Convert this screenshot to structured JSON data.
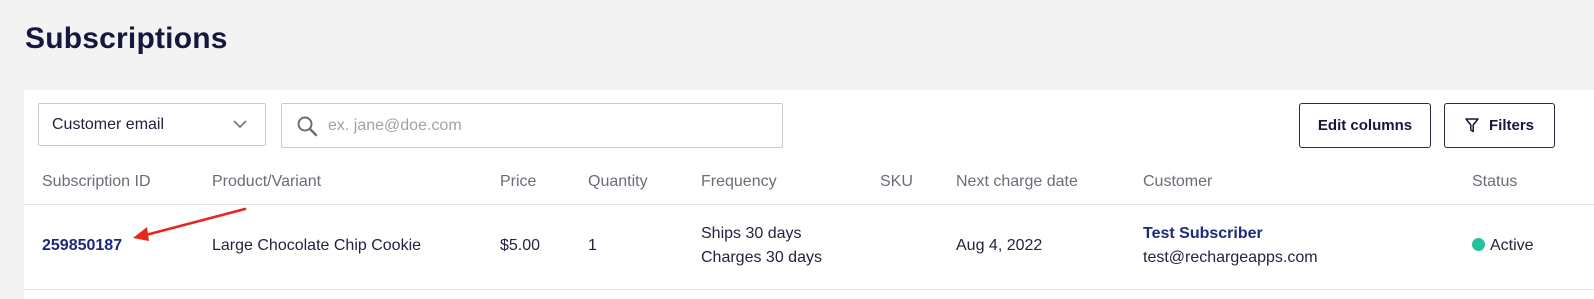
{
  "page": {
    "title": "Subscriptions"
  },
  "toolbar": {
    "filter_select": {
      "selected": "Customer email"
    },
    "search": {
      "placeholder": "ex. jane@doe.com",
      "value": ""
    },
    "edit_columns_label": "Edit columns",
    "filters_label": "Filters"
  },
  "table": {
    "headers": {
      "subscription_id": "Subscription ID",
      "product": "Product/Variant",
      "price": "Price",
      "quantity": "Quantity",
      "frequency": "Frequency",
      "sku": "SKU",
      "next_charge": "Next charge date",
      "customer": "Customer",
      "status": "Status"
    },
    "rows": [
      {
        "subscription_id": "259850187",
        "product": "Large Chocolate Chip Cookie",
        "price": "$5.00",
        "quantity": "1",
        "frequency_ships": "Ships 30 days",
        "frequency_charges": "Charges 30 days",
        "sku": "",
        "next_charge": "Aug 4, 2022",
        "customer_name": "Test Subscriber",
        "customer_email": "test@rechargeapps.com",
        "status": "Active"
      }
    ]
  },
  "colors": {
    "title": "#16163f",
    "link": "#1d2a7c",
    "status_active": "#22c39a",
    "annotation_arrow": "#e8261c"
  },
  "icons": {
    "select_chevron": "chevron-down-icon",
    "search": "search-icon",
    "filters": "funnel-icon",
    "annotation": "red-arrow-annotation"
  }
}
